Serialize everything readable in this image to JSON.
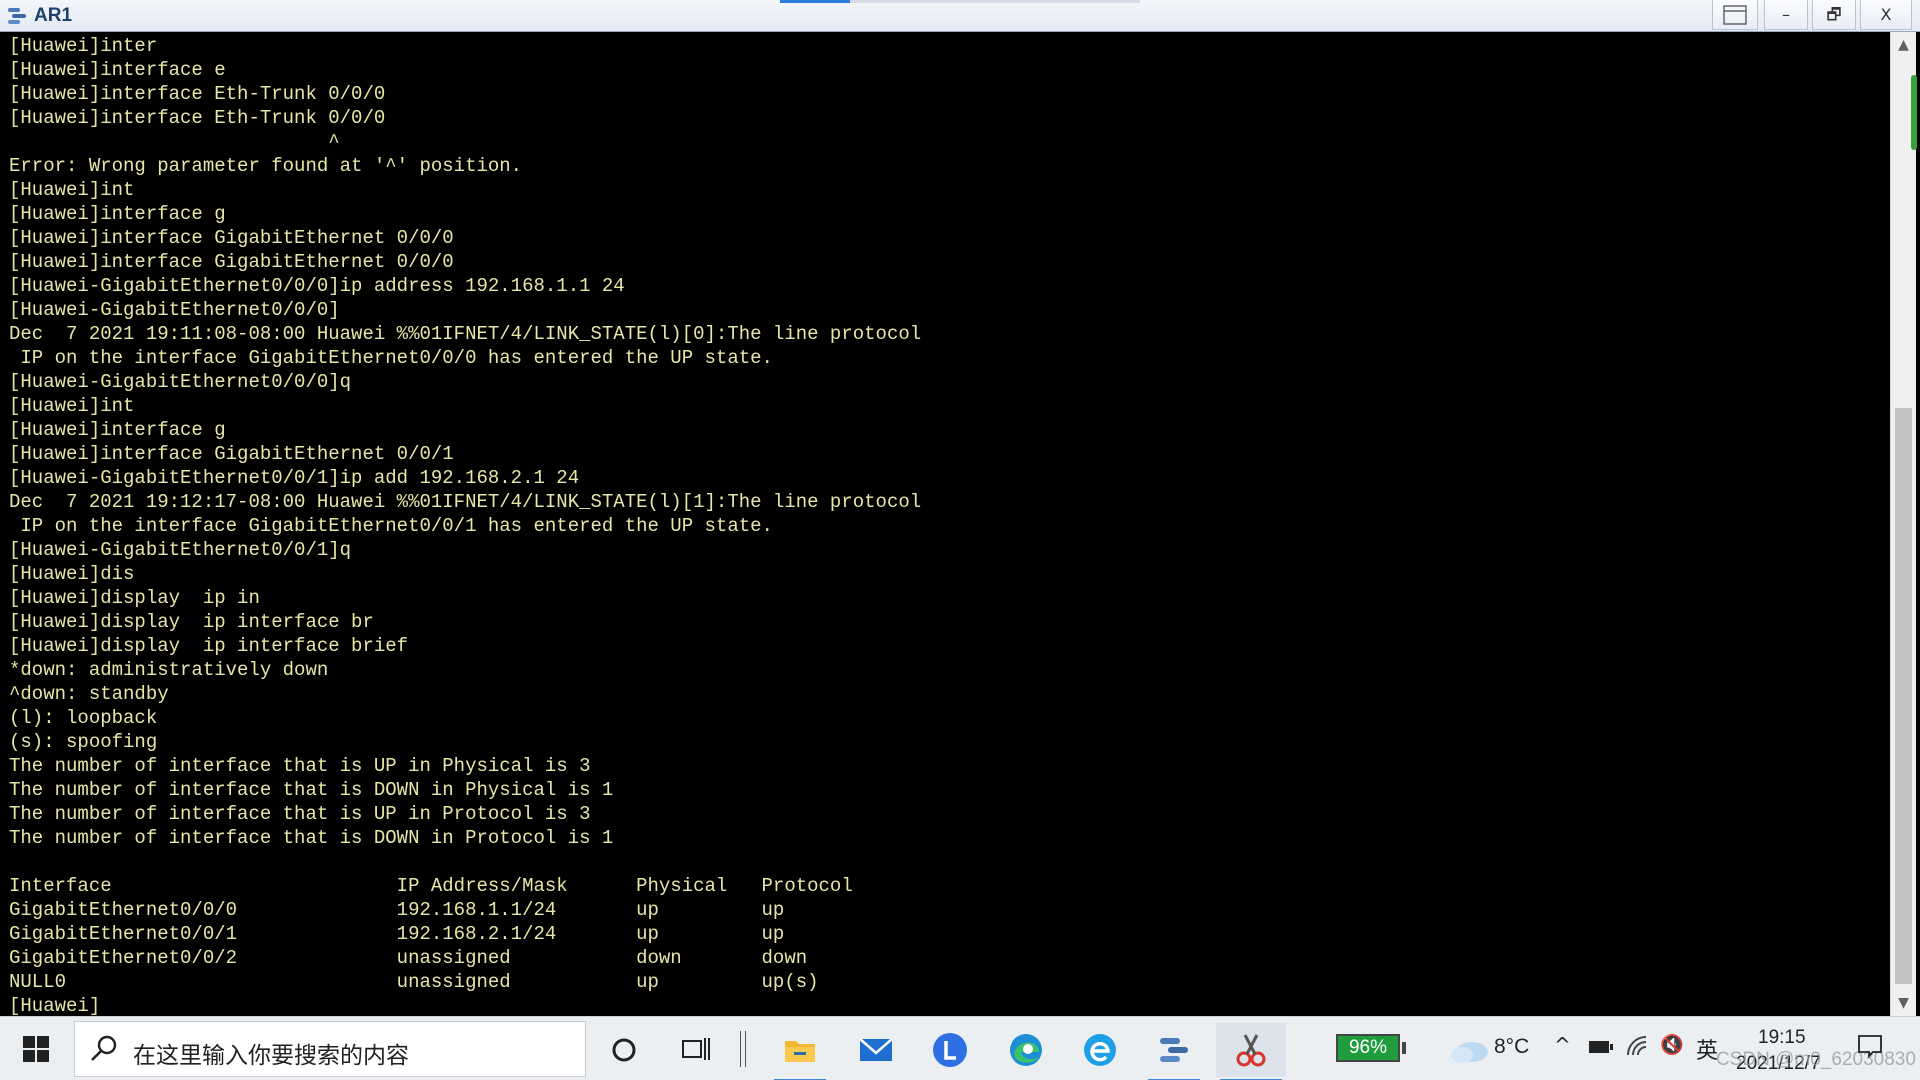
{
  "window": {
    "title": "AR1",
    "buttons": {
      "minimize": "–",
      "maximize": "🗗",
      "close": "X"
    }
  },
  "terminal": {
    "lines": [
      "[Huawei]inter",
      "[Huawei]interface e",
      "[Huawei]interface Eth-Trunk 0/0/0",
      "[Huawei]interface Eth-Trunk 0/0/0",
      "                            ^",
      "Error: Wrong parameter found at '^' position.",
      "[Huawei]int",
      "[Huawei]interface g",
      "[Huawei]interface GigabitEthernet 0/0/0",
      "[Huawei]interface GigabitEthernet 0/0/0",
      "[Huawei-GigabitEthernet0/0/0]ip address 192.168.1.1 24",
      "[Huawei-GigabitEthernet0/0/0]",
      "Dec  7 2021 19:11:08-08:00 Huawei %%01IFNET/4/LINK_STATE(l)[0]:The line protocol",
      " IP on the interface GigabitEthernet0/0/0 has entered the UP state.",
      "[Huawei-GigabitEthernet0/0/0]q",
      "[Huawei]int",
      "[Huawei]interface g",
      "[Huawei]interface GigabitEthernet 0/0/1",
      "[Huawei-GigabitEthernet0/0/1]ip add 192.168.2.1 24",
      "Dec  7 2021 19:12:17-08:00 Huawei %%01IFNET/4/LINK_STATE(l)[1]:The line protocol",
      " IP on the interface GigabitEthernet0/0/1 has entered the UP state.",
      "[Huawei-GigabitEthernet0/0/1]q",
      "[Huawei]dis",
      "[Huawei]display  ip in",
      "[Huawei]display  ip interface br",
      "[Huawei]display  ip interface brief",
      "*down: administratively down",
      "^down: standby",
      "(l): loopback",
      "(s): spoofing",
      "The number of interface that is UP in Physical is 3",
      "The number of interface that is DOWN in Physical is 1",
      "The number of interface that is UP in Protocol is 3",
      "The number of interface that is DOWN in Protocol is 1",
      "",
      "Interface                         IP Address/Mask      Physical   Protocol",
      "GigabitEthernet0/0/0              192.168.1.1/24       up         up",
      "GigabitEthernet0/0/1              192.168.2.1/24       up         up",
      "GigabitEthernet0/0/2              unassigned           down       down",
      "NULL0                             unassigned           up         up(s)",
      "[Huawei]"
    ]
  },
  "taskbar": {
    "search_placeholder": "在这里输入你要搜索的内容",
    "battery_percent": "96%",
    "weather_temp": "8°C",
    "ime_label": "英",
    "clock_time": "19:15",
    "clock_date": "2021/12/7",
    "watermark": "CSDN @m0_62030830",
    "tray_up_arrow": "^",
    "volume_glyph": "🔇"
  },
  "colors": {
    "terminal_bg": "#000000",
    "terminal_text": "#e6e6a8",
    "accent": "#3c8ad8",
    "battery": "#1f9d3c"
  }
}
